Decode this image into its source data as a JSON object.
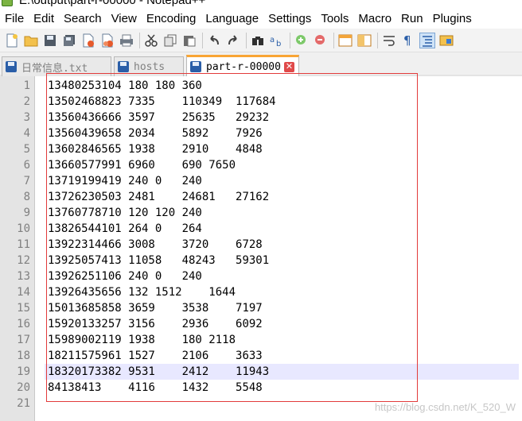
{
  "window": {
    "title": "E:\\output\\part-r-00000 - Notepad++"
  },
  "menu": [
    "File",
    "Edit",
    "Search",
    "View",
    "Encoding",
    "Language",
    "Settings",
    "Tools",
    "Macro",
    "Run",
    "Plugins"
  ],
  "toolbar_icons": [
    "new-file-icon",
    "open-file-icon",
    "save-icon",
    "save-all-icon",
    "close-icon",
    "close-all-icon",
    "print-icon",
    "cut-icon",
    "copy-icon",
    "paste-icon",
    "undo-icon",
    "redo-icon",
    "find-icon",
    "replace-icon",
    "zoom-in-icon",
    "zoom-out-icon",
    "sync-vertical-icon",
    "sync-horizontal-icon",
    "word-wrap-icon",
    "show-all-chars-icon",
    "indent-guide-icon",
    "user-lang-icon"
  ],
  "tabs": [
    {
      "label": "日常信息.txt",
      "active": false
    },
    {
      "label": "hosts",
      "active": false
    },
    {
      "label": "part-r-00000",
      "active": true
    }
  ],
  "editor": {
    "highlighted_line": 19,
    "lines": [
      "13480253104 180 180 360",
      "13502468823 7335\t110349\t117684",
      "13560436666 3597\t25635\t29232",
      "13560439658 2034\t5892\t7926",
      "13602846565 1938\t2910\t4848",
      "13660577991 6960\t690 7650",
      "13719199419 240 0\t240",
      "13726230503 2481\t24681\t27162",
      "13760778710 120 120 240",
      "13826544101 264 0\t264",
      "13922314466 3008\t3720\t6728",
      "13925057413 11058\t48243\t59301",
      "13926251106 240 0\t240",
      "13926435656 132 1512\t1644",
      "15013685858 3659\t3538\t7197",
      "15920133257 3156\t2936\t6092",
      "15989002119 1938\t180 2118",
      "18211575961 1527\t2106\t3633",
      "18320173382 9531\t2412\t11943",
      "84138413\t4116\t1432\t5548",
      ""
    ]
  },
  "watermark": "https://blog.csdn.net/K_520_W"
}
